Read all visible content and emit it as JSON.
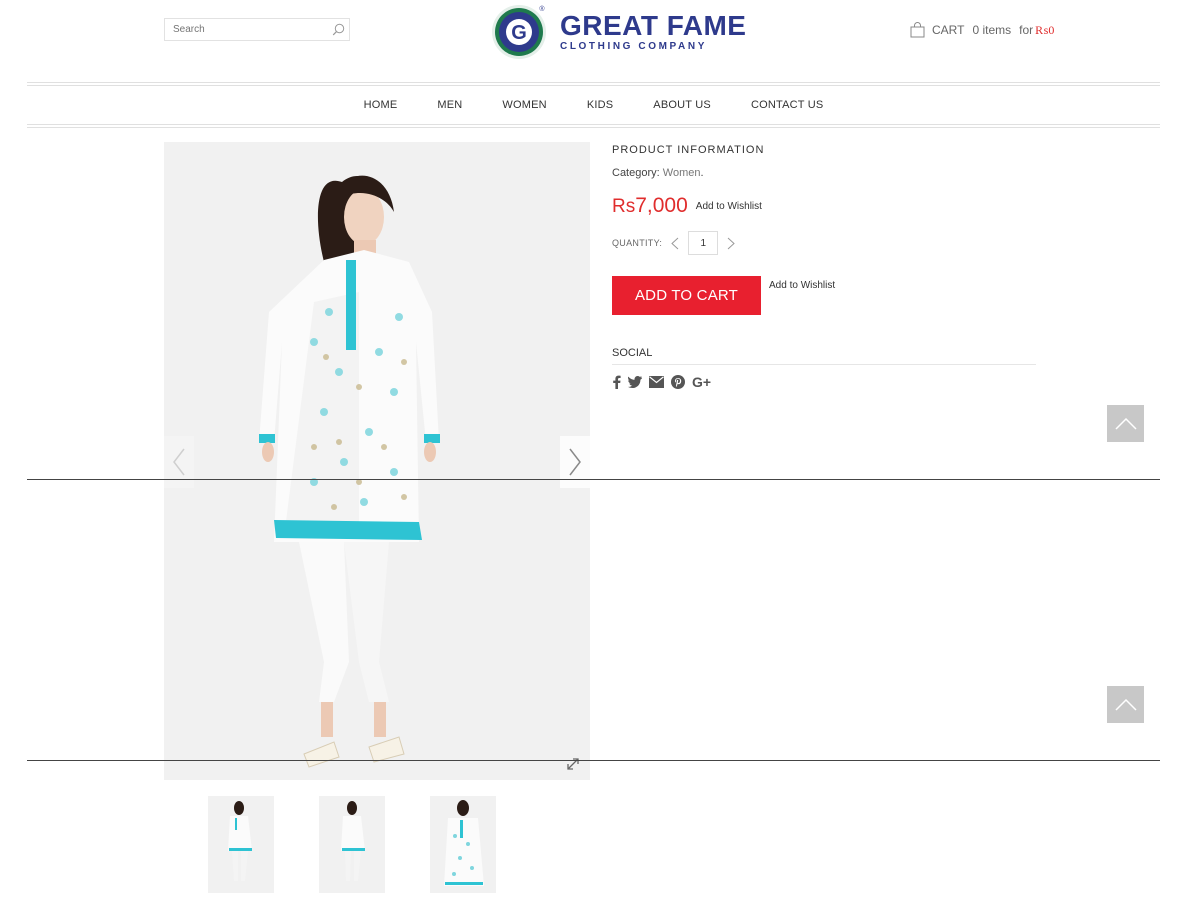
{
  "header": {
    "search": {
      "placeholder": "Search"
    },
    "logo": {
      "brand": "GREAT FAME",
      "tagline": "CLOTHING COMPANY",
      "emblem_letter": "G",
      "registered": "®"
    },
    "cart": {
      "label": "CART",
      "items": "0 items",
      "for_label": "for",
      "total": "₨0"
    }
  },
  "nav": {
    "items": [
      "HOME",
      "MEN",
      "WOMEN",
      "KIDS",
      "ABOUT US",
      "CONTACT US"
    ]
  },
  "product": {
    "section_title": "PRODUCT INFORMATION",
    "category_label": "Category:",
    "category_value": "Women",
    "category_suffix": ".",
    "price_currency": "Rs",
    "price_value": "7,000",
    "wishlist_top": "Add to Wishlist",
    "quantity_label": "QUANTITY:",
    "quantity_value": "1",
    "add_to_cart": "ADD TO CART",
    "wishlist_bottom": "Add to Wishlist",
    "social_title": "SOCIAL",
    "social_icons": [
      "facebook-icon",
      "twitter-icon",
      "email-icon",
      "pinterest-icon",
      "google-plus-icon"
    ]
  },
  "colors": {
    "accent": "#e8202f",
    "price": "#e02d2d",
    "brand": "#2e3a8c",
    "garment_accent": "#2ec3d3"
  }
}
